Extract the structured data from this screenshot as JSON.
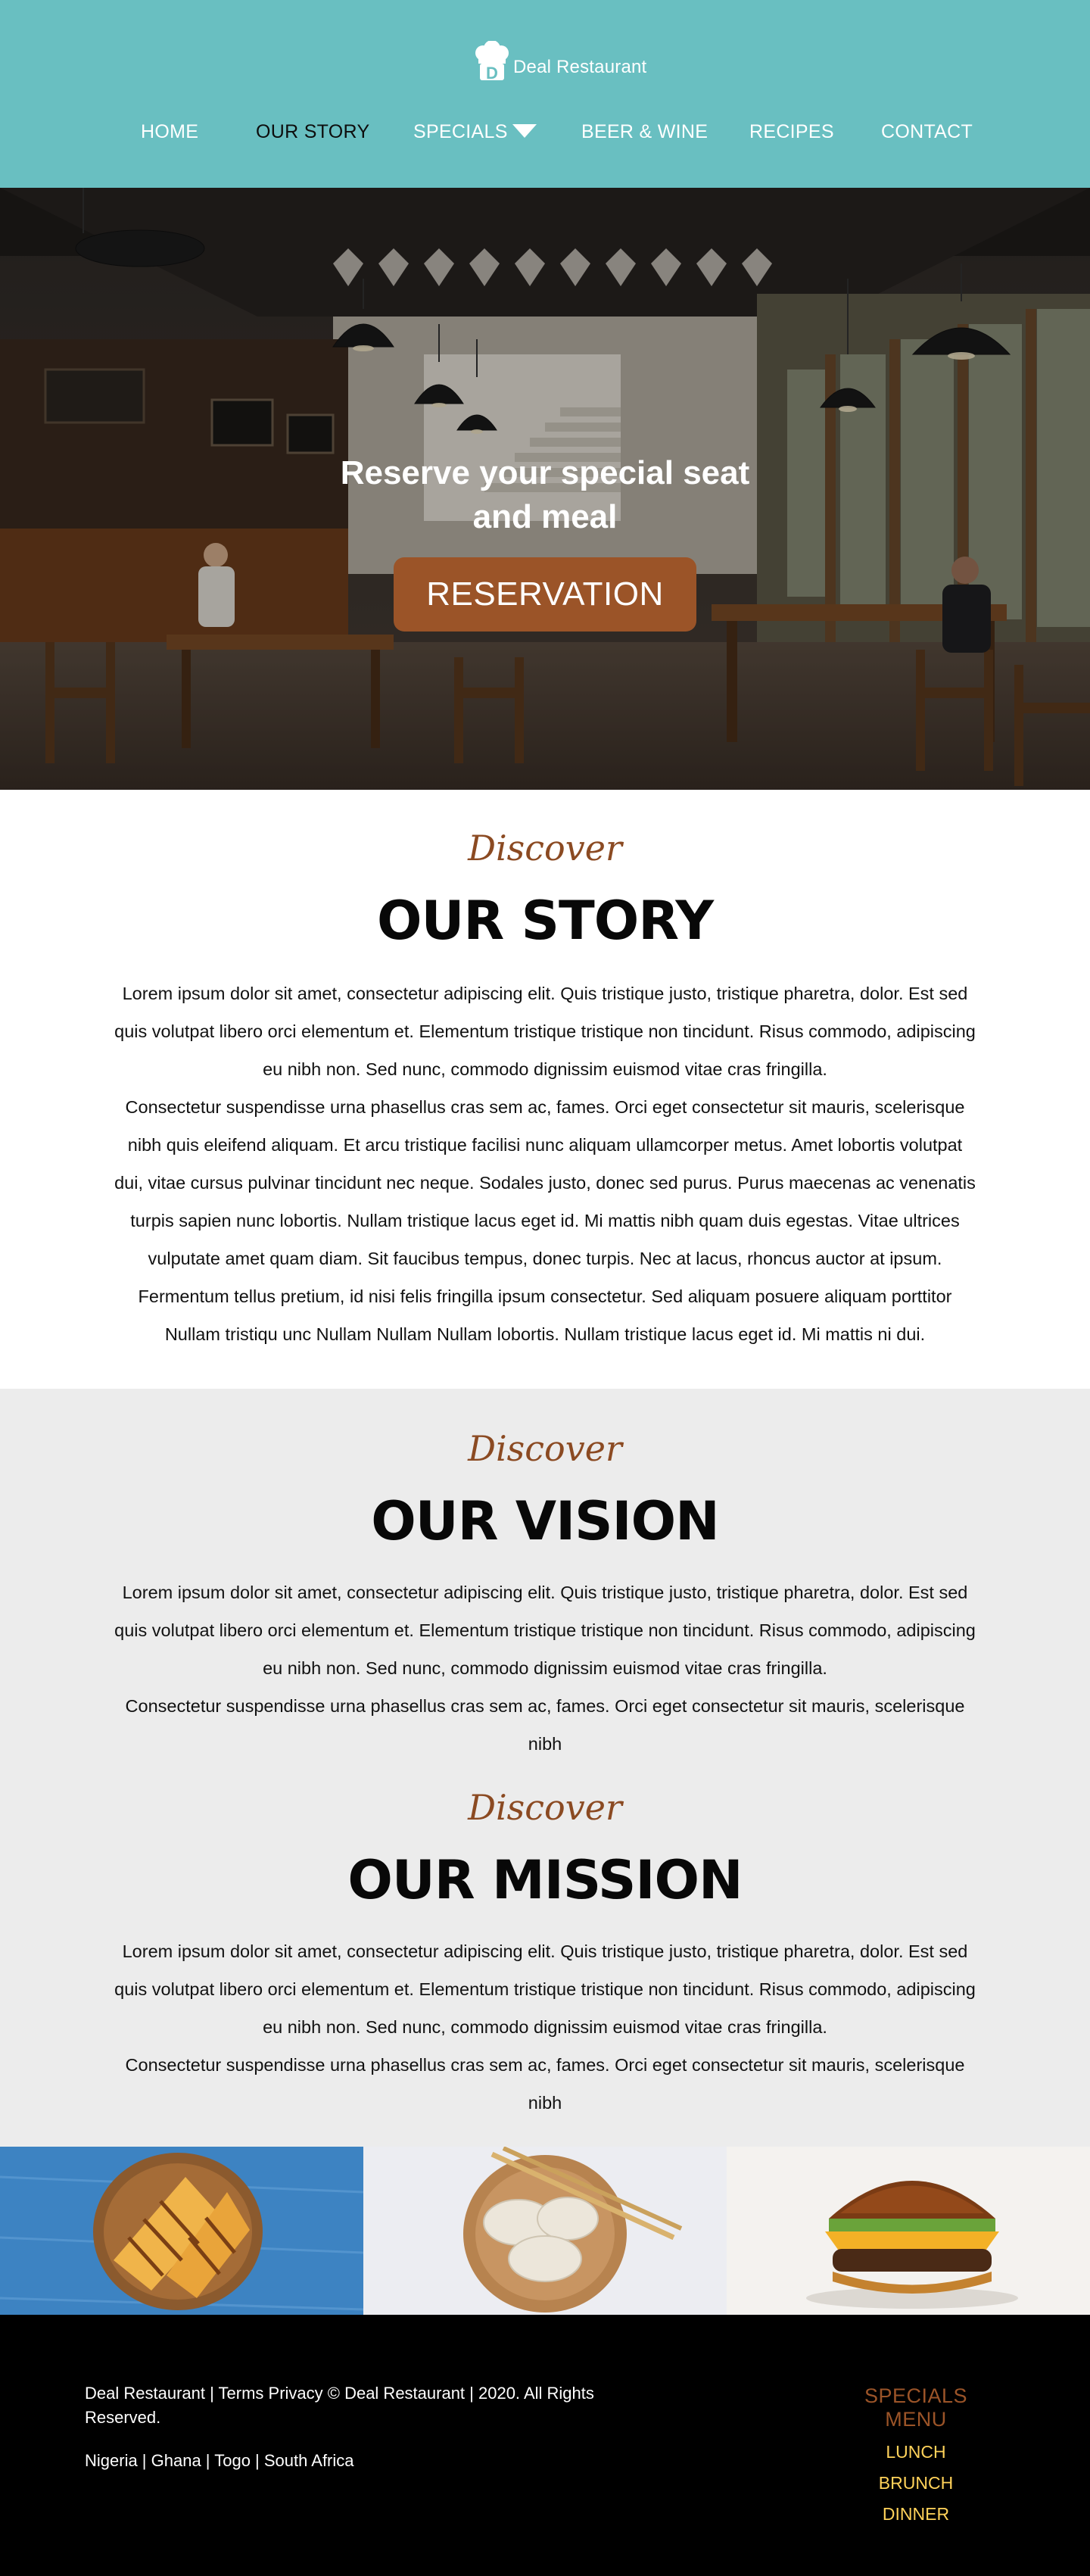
{
  "header": {
    "logo_text": "Deal Restaurant",
    "background_color": "#69bfc1",
    "nav": [
      {
        "label": "HOME",
        "active": false
      },
      {
        "label": "OUR STORY",
        "active": true
      },
      {
        "label": "SPECIALS",
        "active": false,
        "has_dropdown": true
      },
      {
        "label": "BEER & WINE",
        "active": false
      },
      {
        "label": "RECIPES",
        "active": false
      },
      {
        "label": "CONTACT",
        "active": false
      }
    ]
  },
  "hero": {
    "headline": "Reserve your special seat and meal",
    "button_label": "RESERVATION",
    "button_color": "#9b5428"
  },
  "story": {
    "eyebrow": "Discover",
    "title": "OUR STORY",
    "paragraphs": [
      "Lorem ipsum dolor sit amet, consectetur adipiscing elit. Quis tristique justo, tristique pharetra, dolor. Est sed quis volutpat libero orci elementum et. Elementum tristique tristique non tincidunt. Risus commodo, adipiscing eu nibh non. Sed nunc, commodo dignissim euismod vitae cras fringilla.",
      "Consectetur suspendisse urna phasellus cras sem ac, fames. Orci eget consectetur sit mauris, scelerisque nibh quis eleifend aliquam. Et arcu tristique facilisi nunc aliquam ullamcorper metus. Amet lobortis volutpat dui, vitae cursus pulvinar tincidunt nec neque. Sodales justo, donec sed purus. Purus maecenas ac venenatis turpis sapien nunc lobortis. Nullam tristique lacus eget id. Mi mattis nibh quam duis egestas. Vitae ultrices vulputate amet quam diam. Sit faucibus tempus, donec turpis. Nec at lacus, rhoncus auctor at ipsum. Fermentum tellus pretium, id nisi felis fringilla ipsum consectetur. Sed aliquam posuere aliquam porttitor Nullam tristiqu unc Nullam Nullam Nullam lobortis. Nullam tristique lacus eget id. Mi mattis ni dui."
    ]
  },
  "vision": {
    "eyebrow": "Discover",
    "title": "OUR VISION",
    "paragraphs": [
      "Lorem ipsum dolor sit amet, consectetur adipiscing elit. Quis tristique justo, tristique pharetra, dolor. Est sed quis volutpat libero orci elementum et. Elementum tristique tristique non tincidunt. Risus commodo, adipiscing eu nibh non. Sed nunc, commodo dignissim euismod vitae cras fringilla.",
      "Consectetur suspendisse urna phasellus cras sem ac, fames. Orci eget consectetur sit mauris, scelerisque nibh"
    ]
  },
  "mission": {
    "eyebrow": "Discover",
    "title": "OUR MISSION",
    "paragraphs": [
      "Lorem ipsum dolor sit amet, consectetur adipiscing elit. Quis tristique justo, tristique pharetra, dolor. Est sed quis volutpat libero orci elementum et. Elementum tristique tristique non tincidunt. Risus commodo, adipiscing eu nibh non. Sed nunc, commodo dignissim euismod vitae cras fringilla.",
      "Consectetur suspendisse urna phasellus cras sem ac, fames. Orci eget consectetur sit mauris, scelerisque nibh"
    ]
  },
  "food_strip": [
    "grilled-sandwich-image",
    "dumplings-image",
    "burger-image"
  ],
  "footer": {
    "copyright": "Deal Restaurant  |  Terms Privacy © Deal Restaurant  |  2020. All Rights Reserved.",
    "countries": "Nigeria | Ghana | Togo | South Africa",
    "menu_title": "SPECIALS MENU",
    "menu_items": [
      "LUNCH",
      "BRUNCH",
      "DINNER"
    ],
    "menu_title_color": "#9b5428",
    "menu_item_color": "#ffd25a"
  }
}
